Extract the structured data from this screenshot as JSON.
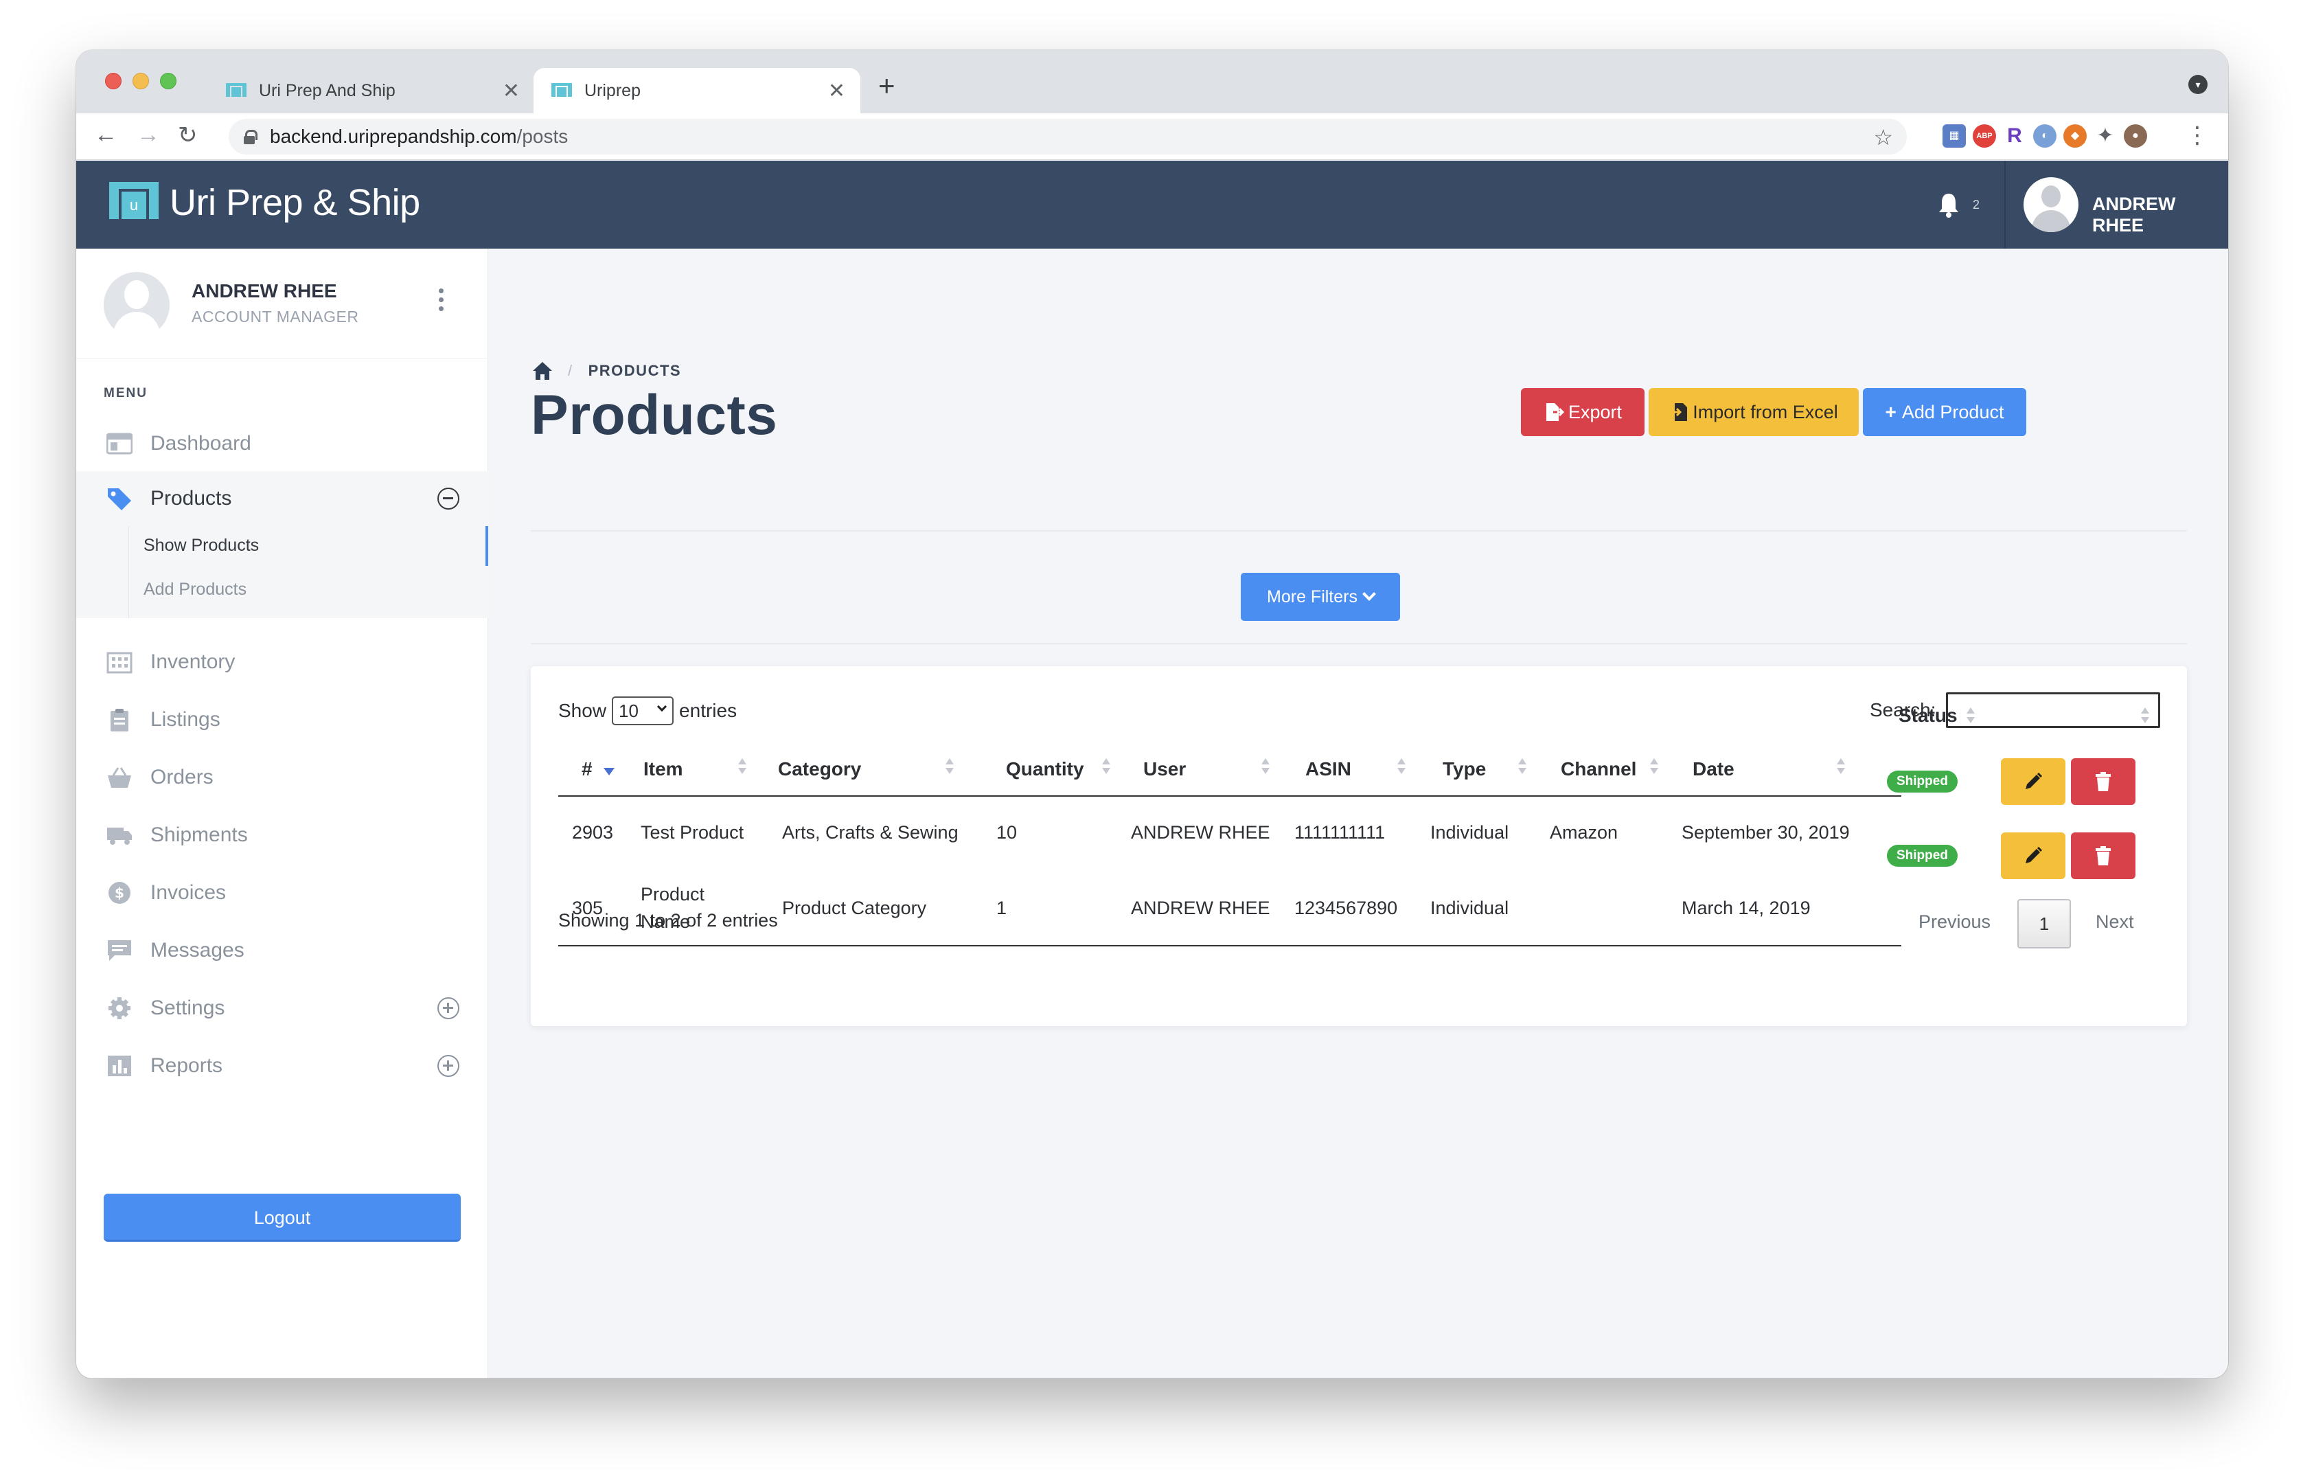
{
  "browser": {
    "tabs": [
      {
        "title": "Uri Prep And Ship"
      },
      {
        "title": "Uriprep"
      }
    ],
    "url_host": "backend.uriprepandship.com",
    "url_path": "/posts"
  },
  "header": {
    "brand": "Uri Prep & Ship",
    "notification_count": "2",
    "user_name": "ANDREW RHEE"
  },
  "sidebar": {
    "profile": {
      "name": "ANDREW RHEE",
      "role": "ACCOUNT MANAGER"
    },
    "menu_label": "MENU",
    "items": [
      {
        "label": "Dashboard",
        "icon": "dashboard-icon"
      },
      {
        "label": "Products",
        "icon": "tag-icon"
      },
      {
        "label": "Inventory",
        "icon": "building-icon"
      },
      {
        "label": "Listings",
        "icon": "clipboard-icon"
      },
      {
        "label": "Orders",
        "icon": "basket-icon"
      },
      {
        "label": "Shipments",
        "icon": "truck-icon"
      },
      {
        "label": "Invoices",
        "icon": "dollar-icon"
      },
      {
        "label": "Messages",
        "icon": "message-icon"
      },
      {
        "label": "Settings",
        "icon": "gear-icon"
      },
      {
        "label": "Reports",
        "icon": "chart-icon"
      }
    ],
    "sub_items": [
      {
        "label": "Show Products"
      },
      {
        "label": "Add Products"
      }
    ],
    "logout_label": "Logout"
  },
  "main": {
    "breadcrumb": "PRODUCTS",
    "title": "Products",
    "buttons": {
      "export": "Export",
      "import": "Import from Excel",
      "add": "Add Product",
      "filters": "More Filters"
    },
    "table_controls": {
      "show_label": "Show",
      "entries_value": "10",
      "entries_label": "entries",
      "search_label": "Search:",
      "search_value": ""
    },
    "table": {
      "headers": [
        "#",
        "Item",
        "Category",
        "Quantity",
        "User",
        "ASIN",
        "Type",
        "Channel",
        "Date",
        "Status"
      ],
      "rows": [
        {
          "id": "2903",
          "item": "Test Product",
          "category": "Arts, Crafts & Sewing",
          "quantity": "10",
          "user": "ANDREW RHEE",
          "asin": "1111111111",
          "type": "Individual",
          "channel": "Amazon",
          "date": "September 30, 2019",
          "status": "Shipped"
        },
        {
          "id": "305",
          "item": "Product Name",
          "category": "Product Category",
          "quantity": "1",
          "user": "ANDREW RHEE",
          "asin": "1234567890",
          "type": "Individual",
          "channel": "",
          "date": "March 14, 2019",
          "status": "Shipped"
        }
      ]
    },
    "pagination": {
      "info": "Showing 1 to 2 of 2 entries",
      "previous": "Previous",
      "current_page": "1",
      "next": "Next"
    }
  },
  "colors": {
    "header_bg": "#394b64",
    "primary": "#4a8ef1",
    "danger": "#d9414a",
    "warning": "#f4bf3b",
    "success": "#3fae49"
  }
}
